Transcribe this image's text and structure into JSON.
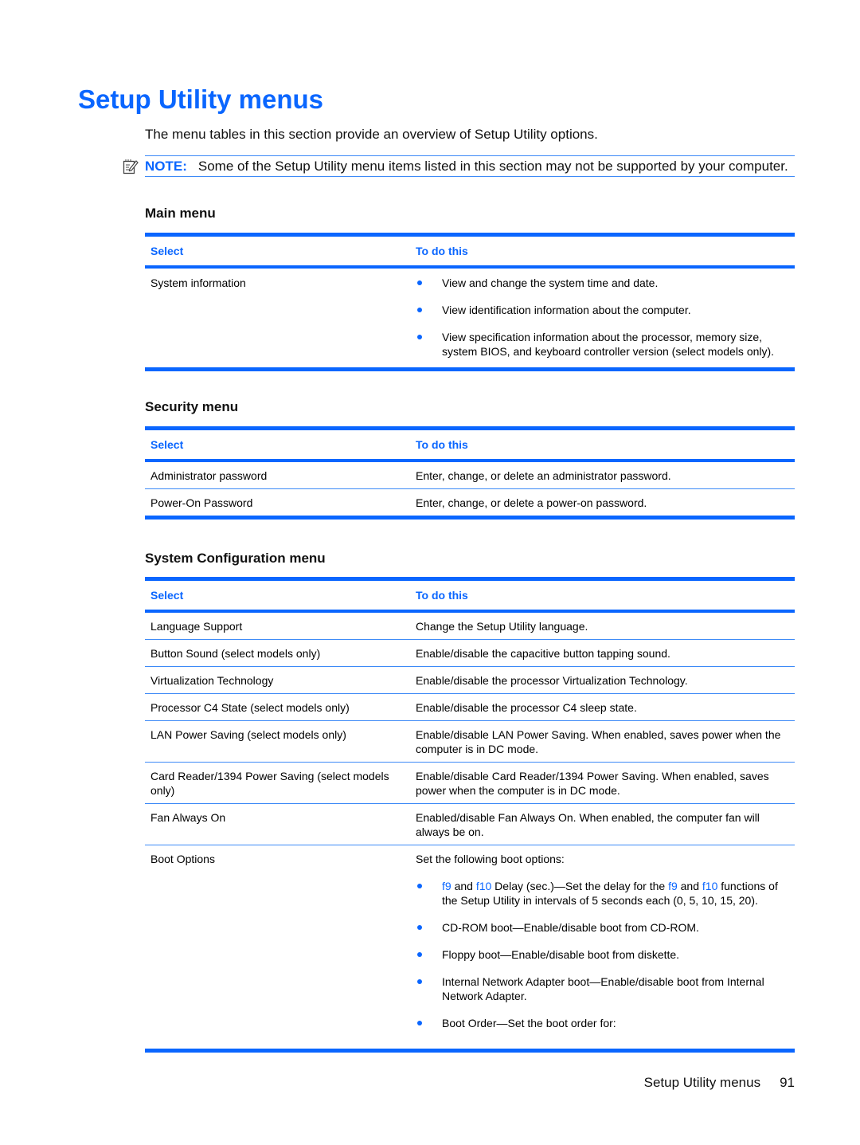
{
  "page": {
    "title": "Setup Utility menus",
    "intro": "The menu tables in this section provide an overview of Setup Utility options.",
    "note": {
      "icon": "note-pencil-icon",
      "label": "NOTE:",
      "text": "Some of the Setup Utility menu items listed in this section may not be supported by your computer."
    }
  },
  "colors": {
    "accent": "#0a66ff",
    "rule": "#3d8af7",
    "text": "#111111"
  },
  "tables": {
    "main": {
      "heading": "Main menu",
      "col_select": "Select",
      "col_todo": "To do this",
      "rows": [
        {
          "select": "System information",
          "bullets": [
            "View and change the system time and date.",
            "View identification information about the computer.",
            "View specification information about the processor, memory size, system BIOS, and keyboard controller version (select models only)."
          ]
        }
      ]
    },
    "security": {
      "heading": "Security menu",
      "col_select": "Select",
      "col_todo": "To do this",
      "rows": [
        {
          "select": "Administrator password",
          "todo": "Enter, change, or delete an administrator password."
        },
        {
          "select": "Power-On Password",
          "todo": "Enter, change, or delete a power-on password."
        }
      ]
    },
    "sysconfig": {
      "heading": "System Configuration menu",
      "col_select": "Select",
      "col_todo": "To do this",
      "rows": [
        {
          "select": "Language Support",
          "todo": "Change the Setup Utility language."
        },
        {
          "select": "Button Sound (select models only)",
          "todo": "Enable/disable the capacitive button tapping sound."
        },
        {
          "select": "Virtualization Technology",
          "todo": "Enable/disable the processor Virtualization Technology."
        },
        {
          "select": "Processor C4 State (select models only)",
          "todo": "Enable/disable the processor C4 sleep state."
        },
        {
          "select": "LAN Power Saving (select models only)",
          "todo": "Enable/disable LAN Power Saving. When enabled, saves power when the computer is in DC mode."
        },
        {
          "select": "Card Reader/1394 Power Saving (select models only)",
          "todo": "Enable/disable Card Reader/1394 Power Saving. When enabled, saves power when the computer is in DC mode."
        },
        {
          "select": "Fan Always On",
          "todo": "Enabled/disable Fan Always On. When enabled, the computer fan will always be on."
        },
        {
          "select": "Boot Options",
          "todo": "Set the following boot options:",
          "bullet1": {
            "k1": "f9",
            "t1": " and ",
            "k2": "f10",
            "t2": " Delay (sec.)—Set the delay for the ",
            "k3": "f9",
            "t3": " and ",
            "k4": "f10",
            "t4": " functions of the Setup Utility in intervals of 5 seconds each (0, 5, 10, 15, 20)."
          },
          "bullets": [
            "CD-ROM boot—Enable/disable boot from CD-ROM.",
            "Floppy boot—Enable/disable boot from diskette.",
            "Internal Network Adapter boot—Enable/disable boot from Internal Network Adapter.",
            "Boot Order—Set the boot order for:"
          ]
        }
      ]
    }
  },
  "footer": {
    "section": "Setup Utility menus",
    "page_number": "91"
  }
}
